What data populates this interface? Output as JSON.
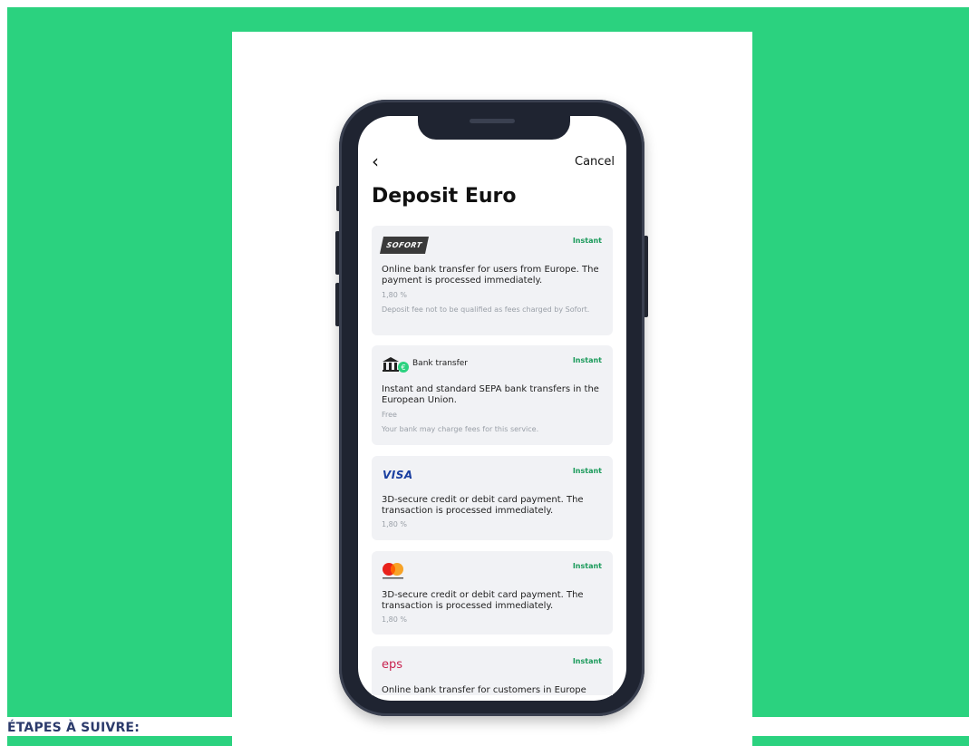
{
  "page": {
    "steps_label": "ÉTAPES À SUIVRE:"
  },
  "colors": {
    "accent_green": "#2bd27f",
    "phone_frame": "#1f2431",
    "instant_badge": "#1a9a5a",
    "visa_blue": "#1a3fa0"
  },
  "app": {
    "back_icon": "chevron-left-icon",
    "back_glyph": "‹",
    "cancel_label": "Cancel",
    "title": "Deposit Euro"
  },
  "methods": [
    {
      "logo_text": "SOFORT",
      "badge": "Instant",
      "description": "Online bank transfer for users from Europe. The payment is processed immediately.",
      "fee": "1,80 %",
      "note": "Deposit fee not to be qualified as fees charged by Sofort."
    },
    {
      "logo_icon": "bank-icon",
      "logo_text": "Bank transfer",
      "badge": "Instant",
      "description": "Instant and standard SEPA bank transfers in the European Union.",
      "fee": "Free",
      "note": "Your bank may charge fees for this service."
    },
    {
      "logo_text": "VISA",
      "badge": "Instant",
      "description": "3D-secure credit or debit card payment. The transaction is processed immediately.",
      "fee": "1,80 %"
    },
    {
      "logo_icon": "mastercard-icon",
      "badge": "Instant",
      "description": "3D-secure credit or debit card payment. The transaction is processed immediately.",
      "fee": "1,80 %"
    },
    {
      "logo_text": "eps",
      "badge": "Instant",
      "description": "Online bank transfer for customers in Europe with"
    }
  ]
}
